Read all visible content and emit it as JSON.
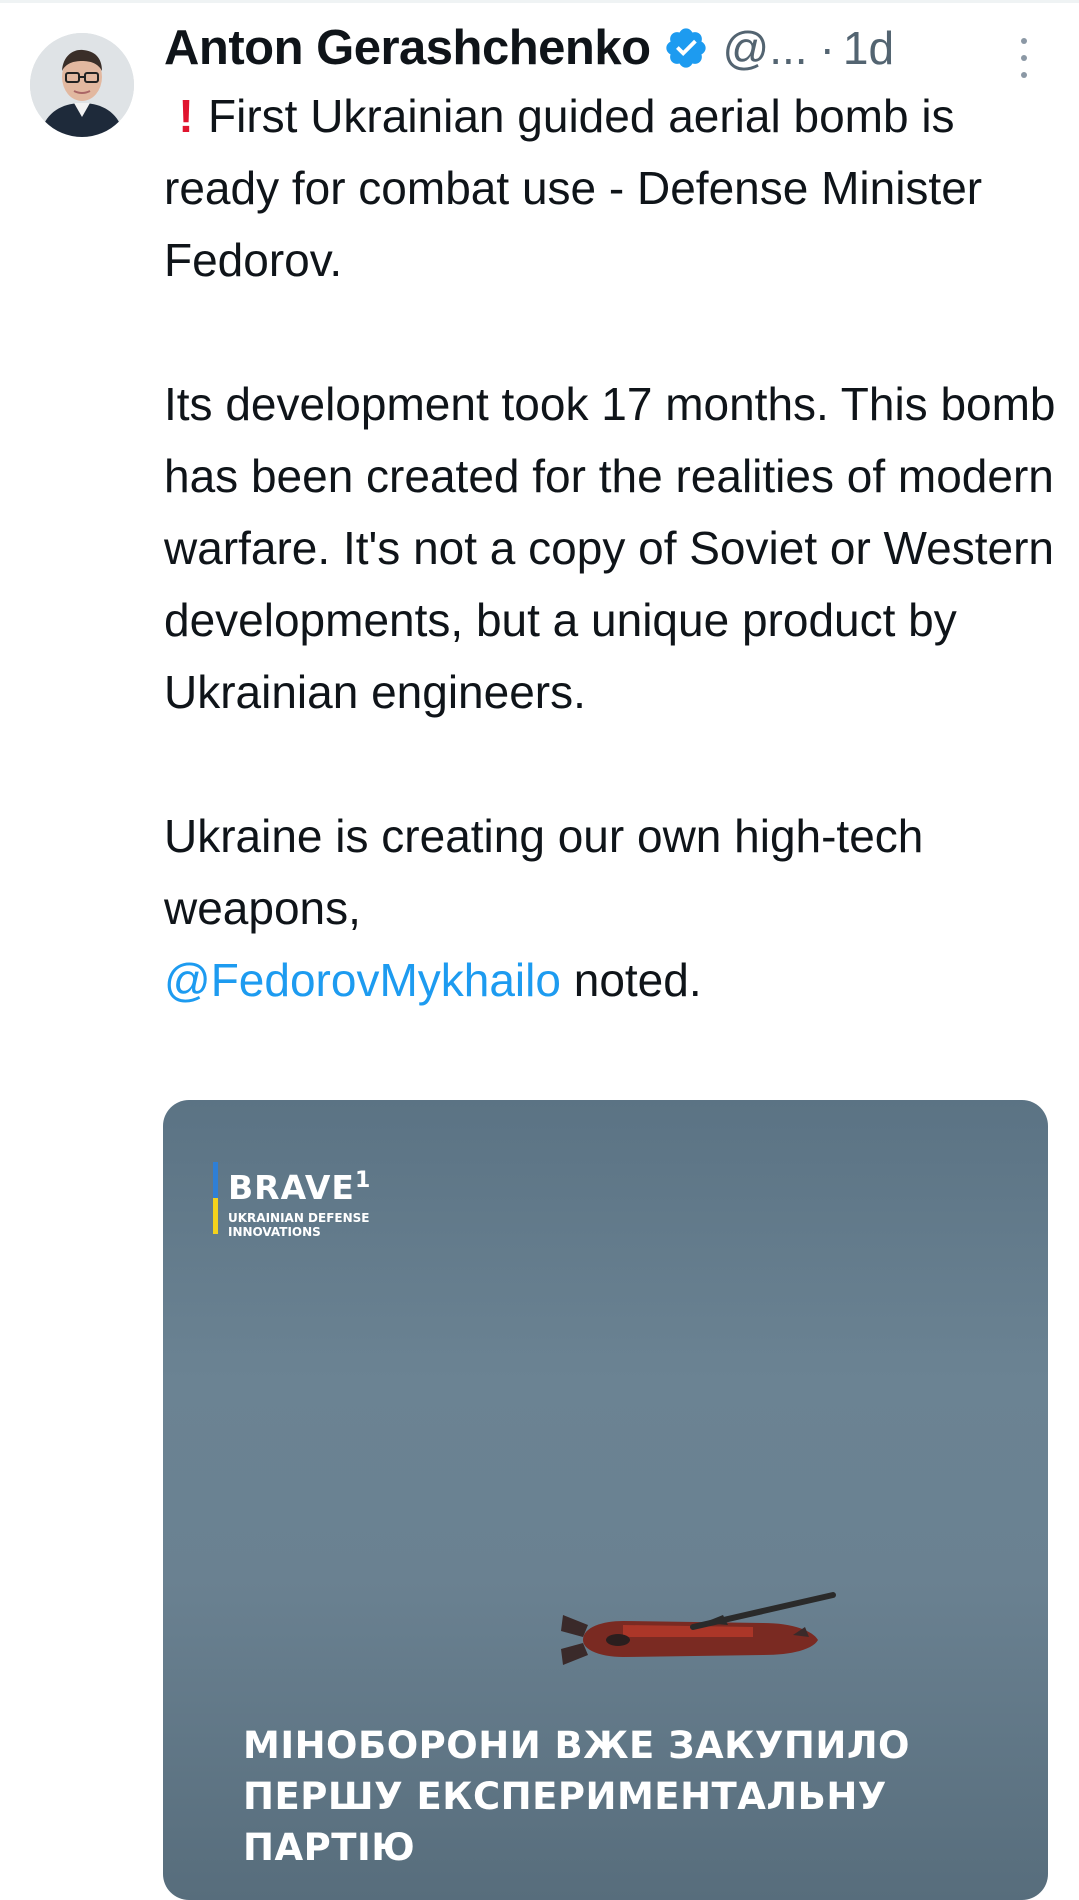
{
  "tweet": {
    "author_name": "Anton Gerashchenko",
    "handle": "@...",
    "separator": "·",
    "time": "1d",
    "verified_color": "#1d9bf0",
    "text": {
      "line1_icon": "red-exclamation-icon",
      "para1": "First Ukrainian guided aerial bomb is ready for combat use - Defense Minister Fedorov.",
      "para2": "Its development took 17 months. This bomb has been created for the realities of modern warfare. It's not a copy of Soviet or Western developments, but a unique product by Ukrainian engineers.",
      "para3_prefix": "Ukraine is creating our own high-tech weapons,",
      "mention": "@FedorovMykhailo",
      "para3_suffix": "noted."
    },
    "media": {
      "brand_name": "BRAVE",
      "brand_sup": "1",
      "brand_subtitle": "UKRAINIAN DEFENSE INNOVATIONS",
      "caption": "МІНОБОРОНИ ВЖЕ ЗАКУПИЛО ПЕРШУ ЕКСПЕРИМЕНТАЛЬНУ ПАРТІЮ"
    }
  },
  "colors": {
    "text": "#0f1419",
    "secondary": "#536471",
    "link": "#1d9bf0",
    "alert": "#e0142e"
  }
}
